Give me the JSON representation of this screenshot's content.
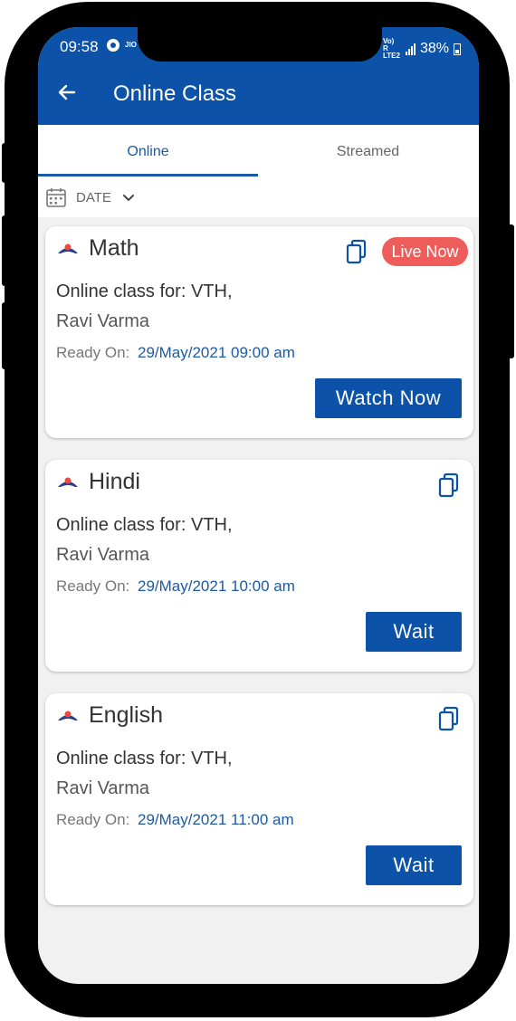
{
  "status_bar": {
    "time": "09:58",
    "small_label": "JIO",
    "network": "Vo) R LTE2",
    "battery": "38%"
  },
  "header": {
    "title": "Online Class"
  },
  "tabs": [
    {
      "label": "Online"
    },
    {
      "label": "Streamed"
    }
  ],
  "filter": {
    "label": "DATE"
  },
  "classes": [
    {
      "subject": "Math",
      "live_badge": "Live Now",
      "class_line": "Online class for: VTH,",
      "teacher": "Ravi Varma",
      "ready_label": "Ready On:",
      "ready_value": "29/May/2021 09:00 am",
      "button": "Watch Now"
    },
    {
      "subject": "Hindi",
      "class_line": "Online class for: VTH,",
      "teacher": "Ravi Varma",
      "ready_label": "Ready On:",
      "ready_value": "29/May/2021 10:00 am",
      "button": "Wait"
    },
    {
      "subject": "English",
      "class_line": "Online class for: VTH,",
      "teacher": "Ravi Varma",
      "ready_label": "Ready On:",
      "ready_value": "29/May/2021 11:00 am",
      "button": "Wait"
    }
  ],
  "colors": {
    "primary": "#0b52a8",
    "live": "#ef5d5a",
    "accent_text": "#1d5aa5"
  },
  "icons": {
    "back": "arrow-left-icon",
    "calendar": "calendar-icon",
    "dropdown": "chevron-down-icon",
    "copy": "copy-icon",
    "subject": "school-logo-icon"
  }
}
